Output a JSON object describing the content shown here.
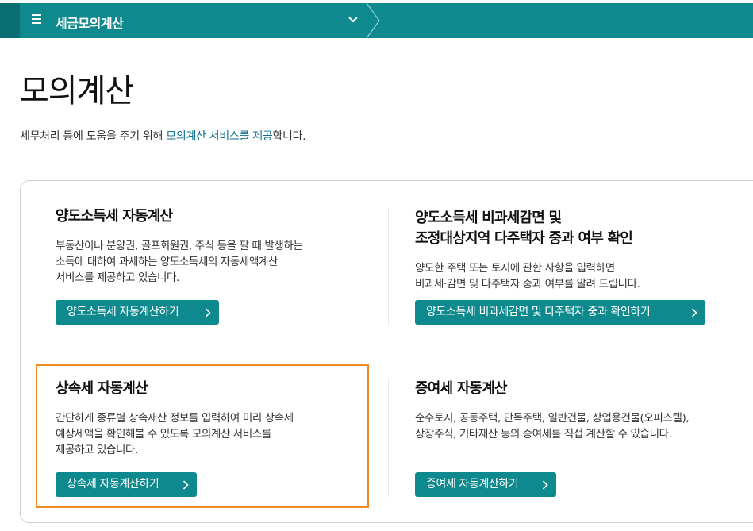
{
  "header": {
    "title": "세금모의계산"
  },
  "page": {
    "title": "모의계산",
    "desc_before": "세무처리 등에 도움을 주기 위해 ",
    "desc_link": "모의계산 서비스를 제공",
    "desc_after": "합니다."
  },
  "cards": [
    {
      "title_lines": [
        "양도소득세 자동계산"
      ],
      "desc_lines": [
        "부동산이나 분양권, 골프회원권, 주식 등을 팔 때 발생하는",
        "소득에 대하여 과세하는 양도소득세의 자동세액계산",
        "서비스를 제공하고 있습니다."
      ],
      "button": "양도소득세 자동계산하기"
    },
    {
      "title_lines": [
        "양도소득세 비과세감면 및",
        "조정대상지역 다주택자 중과 여부 확인"
      ],
      "desc_lines": [
        "양도한 주택 또는 토지에 관한 사항을 입력하면",
        "비과세·감면 및 다주택자 중과 여부를 알려 드립니다."
      ],
      "button": "양도소득세 비과세감면 및 다주택자 중과 확인하기"
    },
    {
      "title_lines": [
        "상속세 자동계산"
      ],
      "desc_lines": [
        "간단하게 종류별 상속재산 정보를 입력하여 미리 상속세",
        "예상세액을 확인해볼 수 있도록 모의계산 서비스를",
        "제공하고 있습니다."
      ],
      "button": "상속세 자동계산하기"
    },
    {
      "title_lines": [
        "증여세 자동계산"
      ],
      "desc_lines": [
        "순수토지, 공동주택, 단독주택, 일반건물, 상업용건물(오피스텔),",
        "상장주식, 기타재산 등의 증여세를 직접 계산할 수 있습니다."
      ],
      "button": "증여세 자동계산하기"
    }
  ],
  "colors": {
    "accent": "#0e8a8f",
    "accent_dark": "#0b6e72",
    "highlight": "#f08a24",
    "link": "#0b6e8f"
  }
}
